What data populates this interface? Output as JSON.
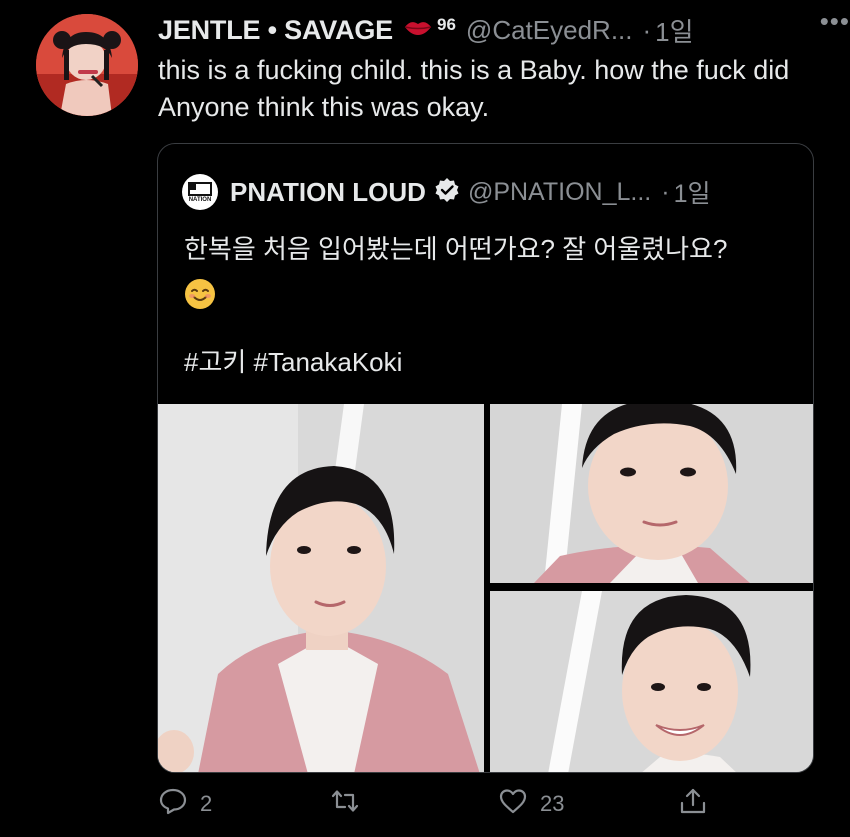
{
  "author": {
    "display_name": "JENTLE • SAVAGE",
    "badge_count": "96",
    "handle": "@CatEyedR...",
    "separator": "·",
    "time": "1일",
    "more_label": "•••"
  },
  "tweet_text": "this is a fucking child. this is a Baby. how the fuck did Anyone think this was okay.",
  "quoted": {
    "avatar_text": "NATION",
    "display_name": "PNATION LOUD",
    "handle": "@PNATION_L...",
    "separator": "·",
    "time": "1일",
    "text_line": "한복을 처음 입어봤는데 어떤가요? 잘 어울렸나요?",
    "hashtags": "#고키 #TanakaKoki"
  },
  "actions": {
    "reply_count": "2",
    "retweet_count": "",
    "like_count": "23"
  },
  "colors": {
    "background": "#000000",
    "text": "#e7e9ea",
    "muted": "#8b8f94",
    "border": "#3a3d41",
    "hanbok_pink": "#d69aa1"
  }
}
